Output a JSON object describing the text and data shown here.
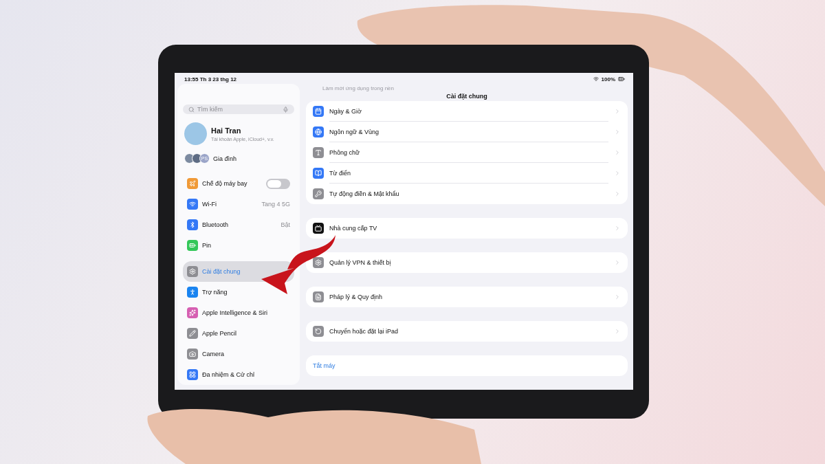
{
  "status_bar": {
    "time": "13:55",
    "date": "Th 3 23 thg 12",
    "battery": "100%"
  },
  "sidebar": {
    "search": {
      "placeholder": "Tìm kiếm"
    },
    "profile": {
      "name": "Hai Tran",
      "subtitle": "Tài khoản Apple, iCloud+, v.v."
    },
    "family": {
      "label": "Gia đình",
      "initials": "PS"
    },
    "groups": [
      [
        {
          "kind": "toggle",
          "label": "Chế độ máy bay",
          "color": "#f09a37",
          "on": false,
          "selected": false
        },
        {
          "kind": "value",
          "label": "Wi-Fi",
          "value": "Tang 4 5G",
          "color": "#3478f6",
          "selected": false
        },
        {
          "kind": "value",
          "label": "Bluetooth",
          "value": "Bật",
          "color": "#3478f6",
          "selected": false
        },
        {
          "kind": "plain",
          "label": "Pin",
          "color": "#34c759",
          "selected": false
        }
      ],
      [
        {
          "kind": "plain",
          "label": "Cài đặt chung",
          "color": "#8e8e93",
          "selected": true
        },
        {
          "kind": "plain",
          "label": "Trợ năng",
          "color": "#1a84f0",
          "selected": false
        },
        {
          "kind": "plain",
          "label": "Apple Intelligence & Siri",
          "color": "#d65fb2",
          "selected": false
        },
        {
          "kind": "plain",
          "label": "Apple Pencil",
          "color": "#8e8e93",
          "selected": false
        },
        {
          "kind": "plain",
          "label": "Camera",
          "color": "#8e8e93",
          "selected": false
        },
        {
          "kind": "plain",
          "label": "Đa nhiệm & Cử chỉ",
          "color": "#3478f6",
          "selected": false
        }
      ]
    ]
  },
  "main": {
    "title": "Cài đặt chung",
    "faded_row": "Làm mới ứng dụng trong nền",
    "groups": [
      [
        {
          "label": "Ngày & Giờ",
          "color": "#3478f6"
        },
        {
          "label": "Ngôn ngữ & Vùng",
          "color": "#3478f6"
        },
        {
          "label": "Phông chữ",
          "color": "#8e8e93"
        },
        {
          "label": "Từ điển",
          "color": "#3478f6"
        },
        {
          "label": "Tự động điền & Mật khẩu",
          "color": "#8e8e93"
        }
      ],
      [
        {
          "label": "Nhà cung cấp TV",
          "color": "#111111"
        }
      ],
      [
        {
          "label": "Quản lý VPN & thiết bị",
          "color": "#8e8e93"
        }
      ],
      [
        {
          "label": "Pháp lý & Quy định",
          "color": "#8e8e93"
        }
      ],
      [
        {
          "label": "Chuyển hoặc đặt lại iPad",
          "color": "#8e8e93"
        }
      ]
    ],
    "shutdown": "Tắt máy"
  }
}
